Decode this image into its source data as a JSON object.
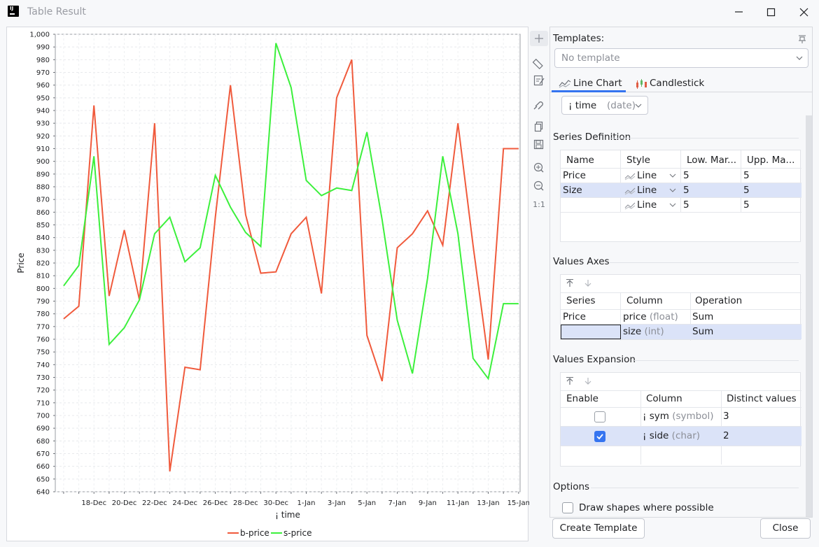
{
  "window": {
    "title": "Table Result"
  },
  "chart_data": {
    "type": "line",
    "xlabel": "¡ time",
    "ylabel": "Price",
    "ylim": [
      640,
      1000
    ],
    "yticks": [
      "640",
      "650",
      "660",
      "670",
      "680",
      "690",
      "700",
      "710",
      "720",
      "730",
      "740",
      "750",
      "760",
      "770",
      "780",
      "790",
      "800",
      "810",
      "820",
      "830",
      "840",
      "850",
      "860",
      "870",
      "880",
      "890",
      "900",
      "910",
      "920",
      "930",
      "940",
      "950",
      "960",
      "970",
      "980",
      "990",
      "1,000"
    ],
    "xticks": [
      "18-Dec",
      "20-Dec",
      "22-Dec",
      "24-Dec",
      "26-Dec",
      "28-Dec",
      "30-Dec",
      "1-Jan",
      "3-Jan",
      "5-Jan",
      "7-Jan",
      "9-Jan",
      "11-Jan",
      "13-Jan",
      "15-Jan"
    ],
    "x": [
      16,
      17,
      18,
      19,
      20,
      21,
      22,
      23,
      24,
      25,
      26,
      27,
      28,
      29,
      30,
      31,
      32,
      33,
      34,
      35,
      36,
      37,
      38,
      39,
      40,
      41,
      42,
      43,
      44,
      45,
      46
    ],
    "x_note_start": "16-Dec",
    "series": [
      {
        "name": "b-price",
        "color": "#f05a3c",
        "values": [
          776,
          786,
          944,
          794,
          846,
          791,
          930,
          656,
          738,
          736,
          856,
          960,
          858,
          812,
          813,
          843,
          856,
          796,
          950,
          980,
          763,
          727,
          832,
          843,
          861,
          834,
          930,
          834,
          744,
          910,
          910
        ]
      },
      {
        "name": "s-price",
        "color": "#3cf03c",
        "values": [
          802,
          818,
          904,
          756,
          769,
          791,
          843,
          856,
          821,
          832,
          889,
          864,
          844,
          833,
          993,
          958,
          885,
          873,
          879,
          877,
          923,
          854,
          775,
          733,
          808,
          904,
          843,
          745,
          729,
          788,
          788
        ]
      }
    ],
    "legend": "bottom-center",
    "grid": true
  },
  "toolbar": {
    "icons": [
      "plus-icon",
      "ruler-icon",
      "edit-icon",
      "magnet-icon",
      "copy-icon",
      "save-icon",
      "zoom-in-icon",
      "zoom-out-icon",
      "actual-size-icon"
    ],
    "actual_size": "1:1"
  },
  "templates": {
    "label": "Templates:",
    "placeholder": "No template"
  },
  "tabs": [
    {
      "label": "Line Chart"
    },
    {
      "label": "Candlestick"
    }
  ],
  "x_axis_combo": {
    "name": "¡ time",
    "type": "(date)"
  },
  "series_definition": {
    "title": "Series Definition",
    "headers": [
      "Name",
      "Style",
      "Low. Mar...",
      "Upp. Ma..."
    ],
    "rows": [
      {
        "name": "Price",
        "style": "Line",
        "low": "5",
        "upp": "5"
      },
      {
        "name": "Size",
        "style": "Line",
        "low": "5",
        "upp": "5"
      },
      {
        "name": "",
        "style": "Line",
        "low": "5",
        "upp": "5"
      }
    ]
  },
  "values_axes": {
    "title": "Values Axes",
    "headers": [
      "Series",
      "Column",
      "Operation"
    ],
    "rows": [
      {
        "series": "Price",
        "column": "price",
        "type": "(float)",
        "operation": "Sum"
      },
      {
        "series": "",
        "column": "size",
        "type": "(int)",
        "operation": "Sum"
      }
    ]
  },
  "values_expansion": {
    "title": "Values Expansion",
    "headers": [
      "Enable",
      "Column",
      "Distinct values"
    ],
    "rows": [
      {
        "enabled": false,
        "column": "¡ sym",
        "type": "(symbol)",
        "distinct": "3"
      },
      {
        "enabled": true,
        "column": "¡ side",
        "type": "(char)",
        "distinct": "2"
      }
    ]
  },
  "options": {
    "title": "Options",
    "draw_shapes": "Draw shapes where possible"
  },
  "buttons": {
    "create_template": "Create Template",
    "close": "Close"
  }
}
